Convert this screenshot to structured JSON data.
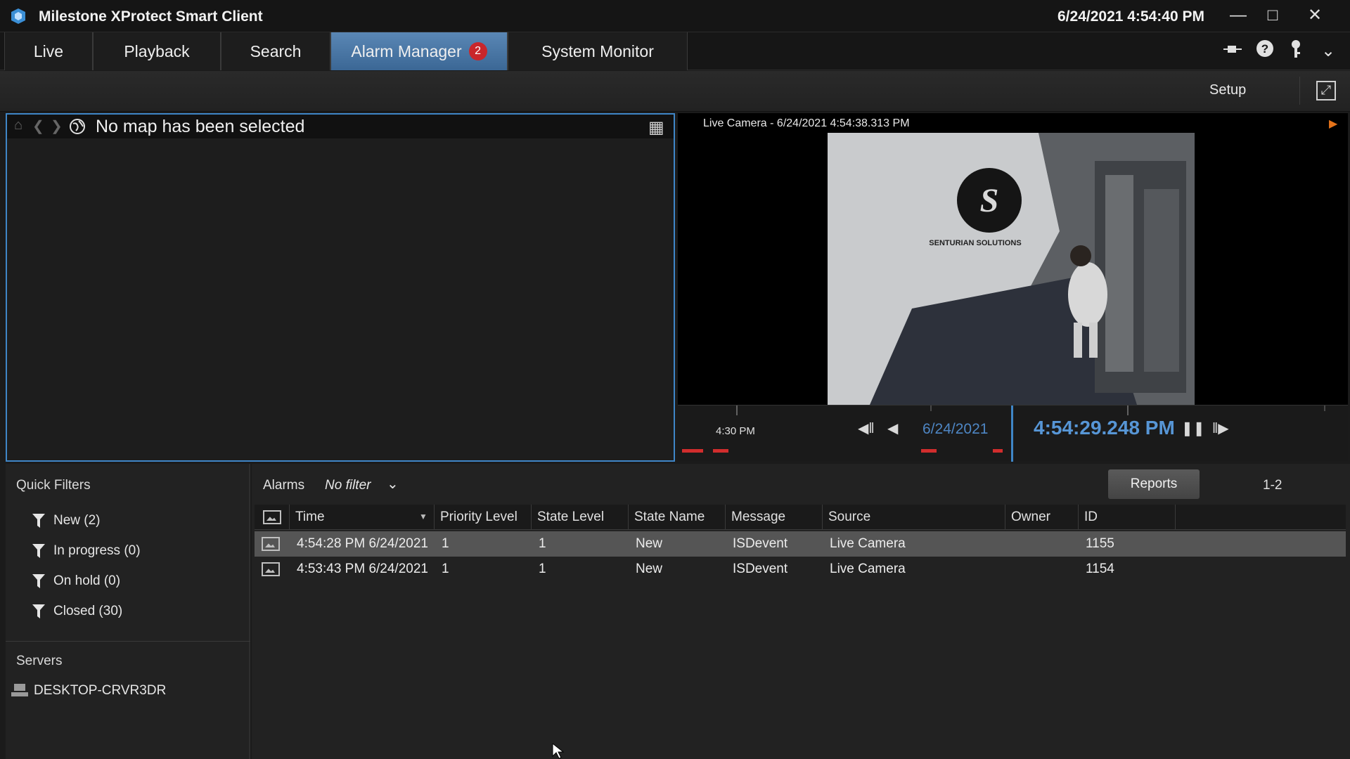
{
  "app": {
    "title": "Milestone XProtect Smart Client",
    "datetime": "6/24/2021 4:54:40 PM"
  },
  "tabs": [
    {
      "label": "Live"
    },
    {
      "label": "Playback"
    },
    {
      "label": "Search"
    },
    {
      "label": "Alarm Manager",
      "badge": "2"
    },
    {
      "label": "System Monitor"
    }
  ],
  "toolbar": {
    "setup_label": "Setup"
  },
  "map": {
    "title": "No map has been selected"
  },
  "camera": {
    "title": "Live Camera - 6/24/2021 4:54:38.313 PM",
    "sign_text": "SENTURIAN SOLUTIONS"
  },
  "timeline": {
    "time_label": "4:30 PM",
    "date": "6/24/2021",
    "clock": "4:54:29.248 PM"
  },
  "quick_filters": {
    "heading": "Quick Filters",
    "items": [
      {
        "label": "New (2)"
      },
      {
        "label": "In progress (0)"
      },
      {
        "label": "On hold (0)"
      },
      {
        "label": "Closed (30)"
      }
    ]
  },
  "servers": {
    "heading": "Servers",
    "items": [
      {
        "label": "DESKTOP-CRVR3DR"
      }
    ]
  },
  "alarms": {
    "label": "Alarms",
    "filter": "No filter",
    "reports_label": "Reports",
    "range": "1-2",
    "columns": [
      "Time",
      "Priority Level",
      "State Level",
      "State Name",
      "Message",
      "Source",
      "Owner",
      "ID"
    ],
    "rows": [
      {
        "time": "4:54:28 PM 6/24/2021",
        "priority": "1",
        "state_level": "1",
        "state_name": "New",
        "message": "ISDevent",
        "source": "Live Camera",
        "owner": "",
        "id": "1155"
      },
      {
        "time": "4:53:43 PM 6/24/2021",
        "priority": "1",
        "state_level": "1",
        "state_name": "New",
        "message": "ISDevent",
        "source": "Live Camera",
        "owner": "",
        "id": "1154"
      }
    ]
  },
  "colors": {
    "accent": "#3f86c7",
    "active_tab": "#4a78a6",
    "badge": "#c9262b",
    "alert_marker": "#d12d2d"
  },
  "icons": [
    "app-logo-icon",
    "minimize-icon",
    "maximize-icon",
    "close-icon",
    "pin-icon",
    "help-icon",
    "key-icon",
    "chevron-down-icon",
    "fullscreen-icon",
    "home-icon",
    "back-icon",
    "forward-icon",
    "globe-icon",
    "grid-icon",
    "play-icon",
    "skip-back-icon",
    "step-back-icon",
    "pause-icon",
    "step-forward-icon",
    "filter-icon",
    "server-icon",
    "image-icon"
  ]
}
